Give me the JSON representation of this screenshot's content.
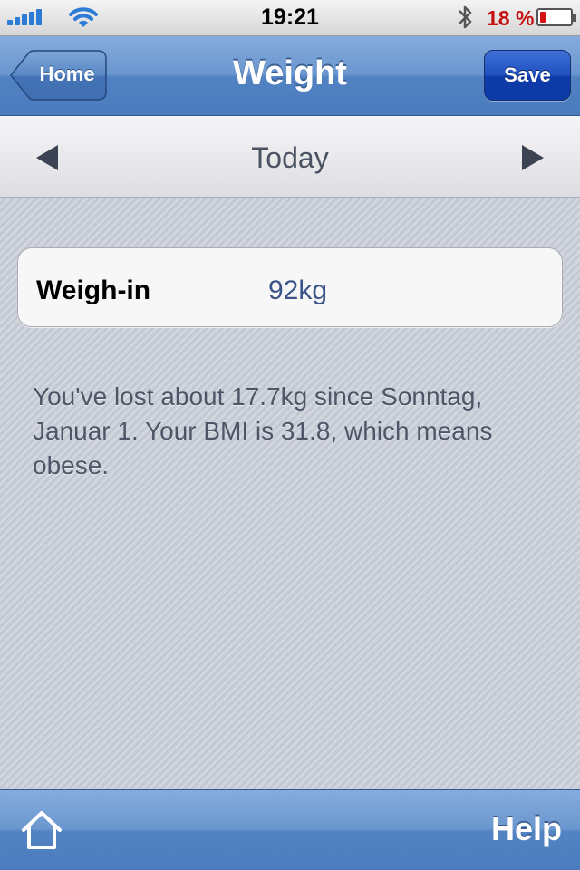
{
  "status_bar": {
    "time": "19:21",
    "battery_percent": "18 %",
    "battery_level": 0.18,
    "signal_bars": 5,
    "icons": [
      "signal-icon",
      "wifi-icon",
      "bluetooth-icon",
      "battery-icon"
    ]
  },
  "navbar": {
    "title": "Weight",
    "back_label": "Home",
    "save_label": "Save"
  },
  "date_nav": {
    "label": "Today",
    "prev_icon": "triangle-left-icon",
    "next_icon": "triangle-right-icon"
  },
  "weigh_in": {
    "label": "Weigh-in",
    "value": "92kg"
  },
  "info_text": "You've lost about 17.7kg since Sonntag, Januar 1. Your BMI is 31.8, which means obese.",
  "toolbar": {
    "home_icon": "home-icon",
    "help_label": "Help"
  },
  "colors": {
    "nav_blue": "#5182c2",
    "save_blue": "#1f4fbe",
    "battery_red": "#c41010",
    "value_blue": "#3b5588"
  }
}
